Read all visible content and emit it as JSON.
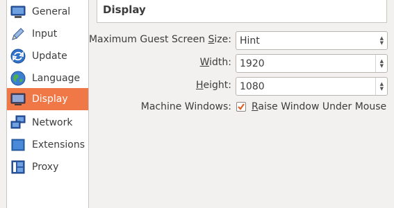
{
  "sidebar": {
    "items": [
      {
        "label": "General",
        "icon": "monitor-icon",
        "active": false
      },
      {
        "label": "Input",
        "icon": "pencil-icon",
        "active": false
      },
      {
        "label": "Update",
        "icon": "refresh-icon",
        "active": false
      },
      {
        "label": "Language",
        "icon": "globe-icon",
        "active": false
      },
      {
        "label": "Display",
        "icon": "display-icon",
        "active": true
      },
      {
        "label": "Network",
        "icon": "network-icon",
        "active": false
      },
      {
        "label": "Extensions",
        "icon": "puzzle-icon",
        "active": false
      },
      {
        "label": "Proxy",
        "icon": "proxy-icon",
        "active": false
      }
    ]
  },
  "header": {
    "title": "Display"
  },
  "form": {
    "max_size": {
      "label_pre": "Maximum Guest Screen ",
      "label_key": "S",
      "label_post": "ize:",
      "value": "Hint"
    },
    "width": {
      "label_key": "W",
      "label_post": "idth:",
      "value": "1920"
    },
    "height": {
      "label_key": "H",
      "label_post": "eight:",
      "value": "1080"
    },
    "machine_windows": {
      "label": "Machine Windows:",
      "checkbox_key": "R",
      "checkbox_post": "aise Window Under Mouse",
      "checked": true
    }
  },
  "colors": {
    "accent": "#f07746",
    "checkbox_check": "#e05e20"
  }
}
